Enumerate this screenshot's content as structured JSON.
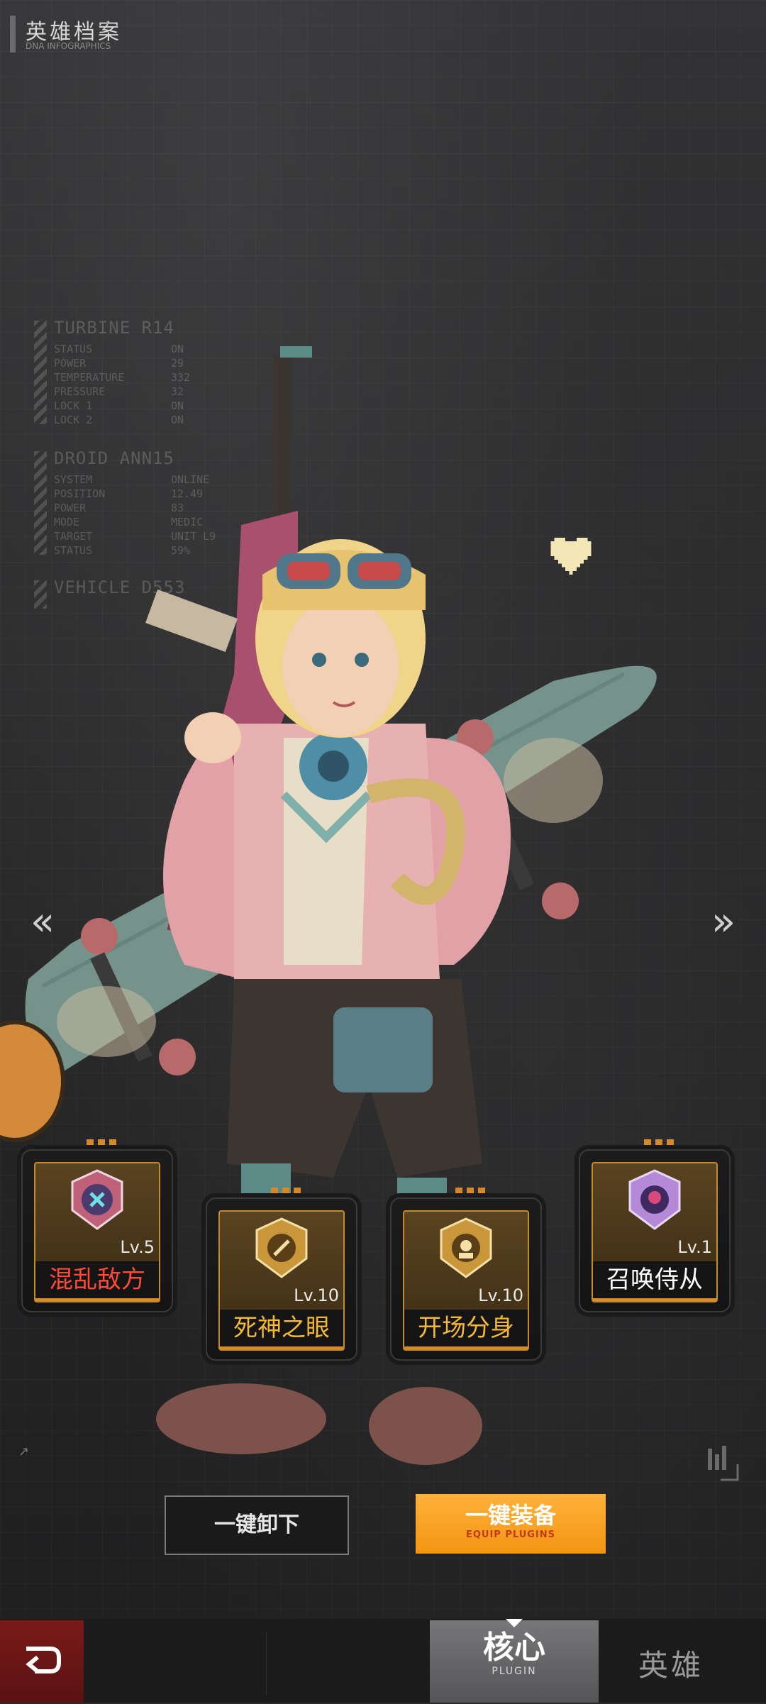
{
  "header": {
    "title": "英雄档案",
    "subtitle": "DNA INFOGRAPHICS"
  },
  "info_panels": [
    {
      "heading": "TURBINE R14",
      "rows": [
        {
          "k": "STATUS",
          "v": "ON"
        },
        {
          "k": "POWER",
          "v": "29"
        },
        {
          "k": "TEMPERATURE",
          "v": "332"
        },
        {
          "k": "PRESSURE",
          "v": "32"
        },
        {
          "k": "LOCK 1",
          "v": "ON"
        },
        {
          "k": "LOCK 2",
          "v": "ON"
        }
      ]
    },
    {
      "heading": "DROID ANN15",
      "rows": [
        {
          "k": "SYSTEM",
          "v": "ONLINE"
        },
        {
          "k": "POSITION",
          "v": "12.49"
        },
        {
          "k": "POWER",
          "v": "83"
        },
        {
          "k": "MODE",
          "v": "MEDIC"
        },
        {
          "k": "TARGET",
          "v": "UNIT L9"
        },
        {
          "k": "STATUS",
          "v": "59%"
        }
      ]
    },
    {
      "heading": "VEHICLE D553",
      "rows": []
    }
  ],
  "plugins": [
    {
      "name": "混乱敌方",
      "level": "Lv.5",
      "name_color": "#ff4a3a",
      "emblem": "chaos-emblem-icon"
    },
    {
      "name": "死神之眼",
      "level": "Lv.10",
      "name_color": "#f5b835",
      "emblem": "reaper-eye-emblem-icon"
    },
    {
      "name": "开场分身",
      "level": "Lv.10",
      "name_color": "#f5b835",
      "emblem": "clone-emblem-icon"
    },
    {
      "name": "召唤侍从",
      "level": "Lv.1",
      "name_color": "#ffffff",
      "emblem": "summon-emblem-icon"
    }
  ],
  "buttons": {
    "unload_all": "一键卸下",
    "equip_all": "一键装备",
    "equip_all_sub": "EQUIP PLUGINS"
  },
  "bottom_nav": {
    "back_icon": "back-arrow-icon",
    "core_label": "核心",
    "core_sub": "PLUGIN",
    "hero_label": "英雄"
  },
  "nav": {
    "prev": "«",
    "next": "»"
  },
  "colors": {
    "accent_orange": "#f39513",
    "plugin_border": "#c58a2c",
    "back_red": "#7a1a1a"
  }
}
